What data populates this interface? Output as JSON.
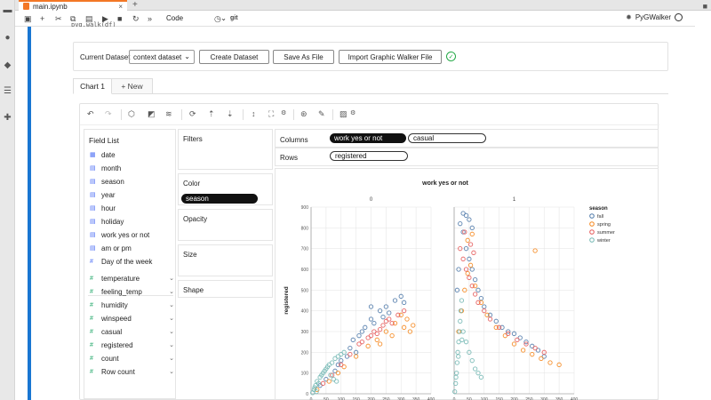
{
  "tabbar": {
    "tab_title": "main.ipynb",
    "close": "×",
    "add": "+"
  },
  "toolbar": {
    "cell_type": "Code",
    "git_label": "git",
    "kernel_name": "PyGWalker"
  },
  "code_snippet": "pyg.walk(df)",
  "pyg": {
    "current_dataset_label": "Current Dataset",
    "dataset_value": "context dataset",
    "create_button": "Create Dataset",
    "save_button": "Save As File",
    "import_button": "Import Graphic Walker File"
  },
  "chart_tabs": {
    "active": "Chart 1",
    "new": "+ New"
  },
  "field_list": {
    "title": "Field List",
    "dimensions": [
      "date",
      "month",
      "season",
      "year",
      "hour",
      "holiday",
      "work yes or not",
      "am or pm",
      "Day of the week"
    ],
    "measures": [
      "temperature",
      "feeling_temp",
      "humidity",
      "winspeed",
      "casual",
      "registered",
      "count",
      "Row count"
    ]
  },
  "shelves": {
    "filters": "Filters",
    "color": "Color",
    "color_field": "season",
    "opacity": "Opacity",
    "size": "Size",
    "shape": "Shape",
    "columns": "Columns",
    "columns_fields": [
      "work yes or not",
      "casual"
    ],
    "rows": "Rows",
    "rows_field": "registered"
  },
  "colors": {
    "accent": "#1976d2",
    "fall": "#4c78a8",
    "spring": "#f58518",
    "summer": "#e45756",
    "winter": "#72b7b2"
  },
  "chart_data": {
    "type": "scatter",
    "title": "work yes or not",
    "facets": [
      "0",
      "1"
    ],
    "ylabel": "registered",
    "ylim": [
      0,
      900
    ],
    "yticks": [
      0,
      100,
      200,
      300,
      400,
      500,
      600,
      700,
      800,
      900
    ],
    "xlim": [
      0,
      400
    ],
    "xticks": [
      0,
      50,
      100,
      150,
      200,
      250,
      300,
      350,
      400
    ],
    "legend": {
      "title": "season",
      "placement": "right",
      "entries": [
        "fall",
        "spring",
        "summer",
        "winter"
      ]
    },
    "series": [
      {
        "name": "fall",
        "facet": "0",
        "points": [
          [
            30,
            40
          ],
          [
            50,
            70
          ],
          [
            80,
            110
          ],
          [
            100,
            160
          ],
          [
            130,
            220
          ],
          [
            160,
            280
          ],
          [
            180,
            320
          ],
          [
            200,
            360
          ],
          [
            230,
            400
          ],
          [
            250,
            420
          ],
          [
            280,
            450
          ],
          [
            300,
            470
          ],
          [
            120,
            180
          ],
          [
            140,
            260
          ],
          [
            170,
            300
          ],
          [
            210,
            340
          ],
          [
            260,
            390
          ],
          [
            240,
            370
          ],
          [
            310,
            440
          ],
          [
            200,
            420
          ],
          [
            150,
            200
          ],
          [
            90,
            140
          ]
        ]
      },
      {
        "name": "spring",
        "facet": "0",
        "points": [
          [
            20,
            20
          ],
          [
            60,
            60
          ],
          [
            90,
            100
          ],
          [
            110,
            130
          ],
          [
            150,
            180
          ],
          [
            190,
            230
          ],
          [
            220,
            260
          ],
          [
            250,
            300
          ],
          [
            280,
            340
          ],
          [
            300,
            380
          ],
          [
            320,
            360
          ],
          [
            330,
            300
          ],
          [
            270,
            280
          ],
          [
            230,
            240
          ],
          [
            310,
            320
          ],
          [
            340,
            330
          ]
        ]
      },
      {
        "name": "summer",
        "facet": "0",
        "points": [
          [
            40,
            50
          ],
          [
            70,
            90
          ],
          [
            100,
            140
          ],
          [
            130,
            190
          ],
          [
            160,
            240
          ],
          [
            190,
            270
          ],
          [
            210,
            300
          ],
          [
            240,
            330
          ],
          [
            260,
            360
          ],
          [
            290,
            380
          ],
          [
            310,
            400
          ],
          [
            200,
            280
          ],
          [
            170,
            250
          ],
          [
            230,
            310
          ],
          [
            270,
            340
          ],
          [
            250,
            350
          ],
          [
            220,
            290
          ]
        ]
      },
      {
        "name": "winter",
        "facet": "0",
        "points": [
          [
            5,
            5
          ],
          [
            10,
            20
          ],
          [
            15,
            40
          ],
          [
            20,
            60
          ],
          [
            30,
            80
          ],
          [
            40,
            100
          ],
          [
            50,
            120
          ],
          [
            60,
            140
          ],
          [
            70,
            150
          ],
          [
            80,
            170
          ],
          [
            90,
            180
          ],
          [
            100,
            190
          ],
          [
            110,
            200
          ],
          [
            25,
            50
          ],
          [
            35,
            90
          ],
          [
            45,
            110
          ],
          [
            55,
            130
          ],
          [
            65,
            90
          ],
          [
            75,
            70
          ],
          [
            85,
            60
          ],
          [
            12,
            30
          ],
          [
            18,
            10
          ]
        ]
      },
      {
        "name": "fall",
        "facet": "1",
        "points": [
          [
            20,
            820
          ],
          [
            30,
            780
          ],
          [
            40,
            700
          ],
          [
            50,
            650
          ],
          [
            60,
            600
          ],
          [
            70,
            550
          ],
          [
            80,
            500
          ],
          [
            90,
            460
          ],
          [
            100,
            420
          ],
          [
            120,
            380
          ],
          [
            140,
            350
          ],
          [
            160,
            320
          ],
          [
            180,
            300
          ],
          [
            200,
            290
          ],
          [
            220,
            270
          ],
          [
            240,
            250
          ],
          [
            260,
            230
          ],
          [
            280,
            210
          ],
          [
            300,
            180
          ],
          [
            40,
            860
          ],
          [
            30,
            870
          ],
          [
            50,
            840
          ],
          [
            60,
            800
          ],
          [
            15,
            600
          ],
          [
            10,
            500
          ]
        ]
      },
      {
        "name": "spring",
        "facet": "1",
        "points": [
          [
            15,
            300
          ],
          [
            25,
            400
          ],
          [
            35,
            500
          ],
          [
            45,
            580
          ],
          [
            55,
            620
          ],
          [
            70,
            520
          ],
          [
            90,
            440
          ],
          [
            110,
            380
          ],
          [
            140,
            320
          ],
          [
            170,
            280
          ],
          [
            200,
            240
          ],
          [
            230,
            210
          ],
          [
            260,
            190
          ],
          [
            290,
            170
          ],
          [
            320,
            150
          ],
          [
            350,
            140
          ],
          [
            270,
            690
          ],
          [
            60,
            770
          ],
          [
            45,
            740
          ]
        ]
      },
      {
        "name": "summer",
        "facet": "1",
        "points": [
          [
            20,
            700
          ],
          [
            30,
            650
          ],
          [
            40,
            600
          ],
          [
            50,
            560
          ],
          [
            60,
            520
          ],
          [
            70,
            480
          ],
          [
            80,
            440
          ],
          [
            100,
            400
          ],
          [
            120,
            360
          ],
          [
            150,
            320
          ],
          [
            180,
            290
          ],
          [
            210,
            260
          ],
          [
            240,
            240
          ],
          [
            270,
            220
          ],
          [
            300,
            200
          ],
          [
            35,
            780
          ],
          [
            55,
            720
          ],
          [
            65,
            680
          ]
        ]
      },
      {
        "name": "winter",
        "facet": "1",
        "points": [
          [
            2,
            10
          ],
          [
            5,
            50
          ],
          [
            8,
            100
          ],
          [
            10,
            150
          ],
          [
            12,
            200
          ],
          [
            15,
            250
          ],
          [
            18,
            300
          ],
          [
            20,
            350
          ],
          [
            22,
            400
          ],
          [
            25,
            450
          ],
          [
            30,
            300
          ],
          [
            40,
            250
          ],
          [
            50,
            200
          ],
          [
            60,
            160
          ],
          [
            70,
            120
          ],
          [
            80,
            100
          ],
          [
            90,
            80
          ],
          [
            6,
            80
          ],
          [
            14,
            180
          ],
          [
            26,
            260
          ]
        ]
      }
    ]
  }
}
